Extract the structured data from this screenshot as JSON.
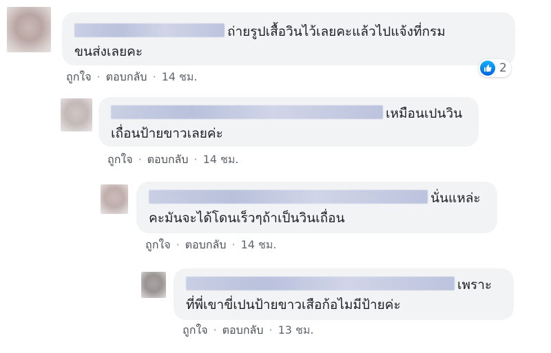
{
  "comments": [
    {
      "text_line1": "ถ่ายรูปเสื้อวินไว้เลยคะแล้วไปแจ้งที่กรม",
      "text_line2": "ขนส่งเลยคะ",
      "like": "ถูกใจ",
      "reply": "ตอบกลับ",
      "time": "14 ชม.",
      "reaction_count": "2"
    },
    {
      "text_line1": "เหมือนเปนวิน",
      "text_line2": "เถื่อนป้ายขาวเลยค่ะ",
      "like": "ถูกใจ",
      "reply": "ตอบกลับ",
      "time": "14 ชม."
    },
    {
      "text_line1": "นั่นแหล่ะ",
      "text_line2": "คะมันจะได้โดนเร็วๆถ้าเป็นวินเถื่อน",
      "like": "ถูกใจ",
      "reply": "ตอบกลับ",
      "time": "14 ชม."
    },
    {
      "text_line1": "เพราะ",
      "text_line2": "ที่พี่เขาขี่เปนป้ายขาวเสือก้อไมมีป้ายค่ะ",
      "like": "ถูกใจ",
      "reply": "ตอบกลับ",
      "time": "13 ชม."
    }
  ],
  "separator": "·",
  "colors": {
    "bubble": "#f2f3f5",
    "like_blue": "#1877f2",
    "meta": "#606770"
  }
}
